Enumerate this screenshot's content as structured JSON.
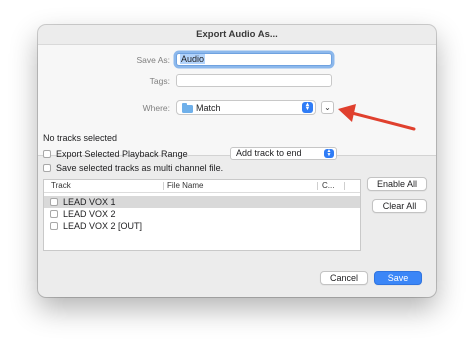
{
  "dialog": {
    "title": "Export Audio As...",
    "save_as_label": "Save As:",
    "save_as_value": "Audio",
    "tags_label": "Tags:",
    "where_label": "Where:",
    "where_value": "Match",
    "expand_glyph": "⌄",
    "stepper_up": "▲",
    "stepper_down": "▼"
  },
  "options": {
    "status": "No tracks selected",
    "export_range_label": "Export Selected Playback Range",
    "multichannel_label": "Save selected tracks as multi channel file.",
    "add_track_value": "Add track to end"
  },
  "table": {
    "headers": {
      "track": "Track",
      "file_name": "File Name",
      "channel": "C..."
    },
    "rows": [
      {
        "label": "LEAD VOX 1"
      },
      {
        "label": "LEAD VOX 2"
      },
      {
        "label": "LEAD VOX 2 [OUT]"
      }
    ]
  },
  "side_buttons": {
    "enable_all": "Enable All",
    "clear_all": "Clear All"
  },
  "footer": {
    "cancel": "Cancel",
    "save": "Save"
  },
  "colors": {
    "accent": "#3b86f7",
    "annotation_arrow": "#e0402e",
    "selection": "#b2d3fb"
  },
  "icons": [
    "folder-icon",
    "chevron-down-icon",
    "stepper-icon",
    "annotation-arrow"
  ]
}
